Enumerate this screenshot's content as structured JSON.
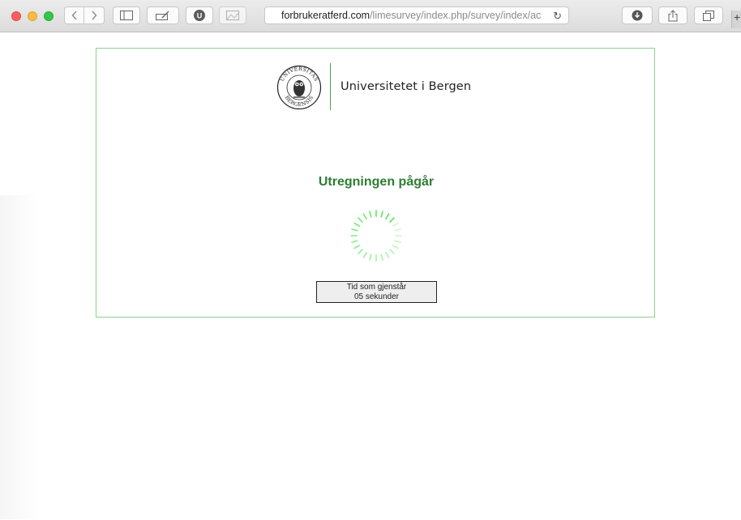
{
  "browser": {
    "url_host": "forbrukeratferd.com",
    "url_path": "/limesurvey/index.php/survey/index/ac",
    "reload_icon": "reload-icon",
    "plus": "+"
  },
  "header": {
    "institution": "Universitetet i Bergen",
    "seal_icon": "uib-seal-icon",
    "seal_text": "UNIVERSITAS BERGENSIS"
  },
  "main": {
    "title": "Utregningen pågår",
    "timer_label": "Tid som gjenstår",
    "timer_value": "05 sekunder"
  },
  "colors": {
    "accent": "#2e7d32",
    "border": "#8fd08f",
    "spinner": "#49e34a"
  }
}
